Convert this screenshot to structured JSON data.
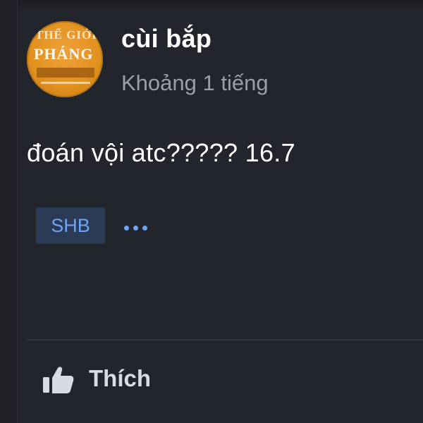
{
  "post": {
    "author": "cùi bắp",
    "time": "Khoảng 1 tiếng",
    "text": "đoán vội atc????? 16.7",
    "avatar_text": "PHÁNG",
    "tags": [
      {
        "label": "SHB"
      }
    ],
    "more_icon": "ellipsis-icon"
  },
  "actions": {
    "like_label": "Thích",
    "like_icon": "thumbs-up-icon"
  },
  "colors": {
    "background": "#22252b",
    "text_primary": "#ffffff",
    "text_secondary": "#9aa0a8",
    "accent": "#6ea4f5",
    "tag_background": "#2b3a55",
    "divider": "#343840"
  }
}
